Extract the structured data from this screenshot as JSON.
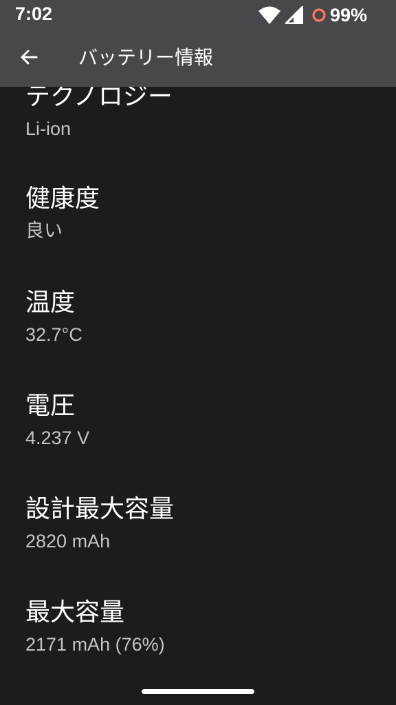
{
  "status_bar": {
    "time": "7:02",
    "battery_percent": "99%",
    "battery_ring_color": "#ff7a55",
    "icons": [
      "wifi-icon",
      "signal-icon",
      "battery-saver-ring-icon"
    ]
  },
  "app_bar": {
    "back_icon": "arrow-back-icon",
    "title": "バッテリー情報"
  },
  "items": [
    {
      "title": "テクノロジー",
      "value": "Li-ion"
    },
    {
      "title": "健康度",
      "value": "良い"
    },
    {
      "title": "温度",
      "value": "32.7°C"
    },
    {
      "title": "電圧",
      "value": "4.237 V"
    },
    {
      "title": "設計最大容量",
      "value": "2820 mAh"
    },
    {
      "title": "最大容量",
      "value": "2171 mAh (76%)"
    }
  ]
}
